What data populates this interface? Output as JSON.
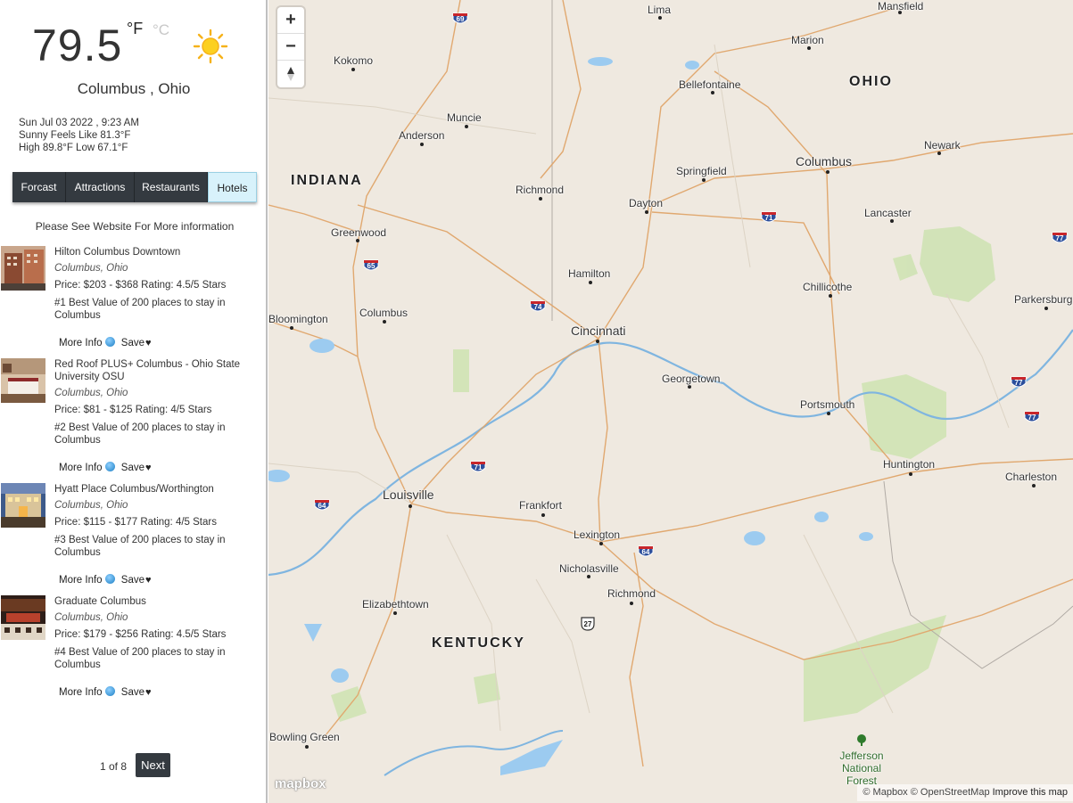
{
  "weather": {
    "temperature": "79.5",
    "unit_f": "°F",
    "unit_c": "°C",
    "icon": "sun-icon",
    "location": "Columbus , Ohio",
    "datetime": "Sun Jul 03 2022 , 9:23 AM",
    "feels": "Sunny Feels Like 81.3°F",
    "high_low": "High 89.8°F Low 67.1°F"
  },
  "tabs": [
    {
      "label": "Forcast",
      "active": false
    },
    {
      "label": "Attractions",
      "active": false
    },
    {
      "label": "Restaurants",
      "active": false
    },
    {
      "label": "Hotels",
      "active": true
    }
  ],
  "notice": "Please See Website For More information",
  "hotels": [
    {
      "name": "Hilton Columbus Downtown",
      "location": "Columbus, Ohio",
      "price": "Price: $203 - $368 Rating: 4.5/5 Stars",
      "rank": "#1 Best Value of 200 places to stay in Columbus",
      "more": "More Info",
      "save": "Save"
    },
    {
      "name": "Red Roof PLUS+ Columbus - Ohio State University OSU",
      "location": "Columbus, Ohio",
      "price": "Price: $81 - $125 Rating: 4/5 Stars",
      "rank": "#2 Best Value of 200 places to stay in Columbus",
      "more": "More Info",
      "save": "Save"
    },
    {
      "name": "Hyatt Place Columbus/Worthington",
      "location": "Columbus, Ohio",
      "price": "Price: $115 - $177 Rating: 4/5 Stars",
      "rank": "#3 Best Value of 200 places to stay in Columbus",
      "more": "More Info",
      "save": "Save"
    },
    {
      "name": "Graduate Columbus",
      "location": "Columbus, Ohio",
      "price": "Price: $179 - $256 Rating: 4.5/5 Stars",
      "rank": "#4 Best Value of 200 places to stay in Columbus",
      "more": "More Info",
      "save": "Save"
    }
  ],
  "pager": {
    "text": "1 of 8",
    "next": "Next"
  },
  "map": {
    "zoom_in": "+",
    "zoom_out": "−",
    "logo": "mapbox",
    "attribution": "© Mapbox © OpenStreetMap",
    "improve": "Improve this map",
    "states": [
      "INDIANA",
      "OHIO",
      "KENTUCKY"
    ],
    "cities": [
      "Lima",
      "Mansfield",
      "Marion",
      "Kokomo",
      "Bellefontaine",
      "Muncie",
      "Anderson",
      "Newark",
      "Springfield",
      "Columbus",
      "Richmond",
      "Dayton",
      "Lancaster",
      "Greenwood",
      "Hamilton",
      "Chillicothe",
      "Parkersburg",
      "Bloomington",
      "Columbus",
      "Cincinnati",
      "Georgetown",
      "Portsmouth",
      "Huntington",
      "Charleston",
      "Louisville",
      "Frankfort",
      "Lexington",
      "Nicholasville",
      "Richmond",
      "Elizabethtown",
      "Bowling Green",
      "Jefferson National Forest"
    ],
    "highways": [
      "69",
      "65",
      "74",
      "71",
      "71",
      "77",
      "77",
      "77",
      "64",
      "64",
      "27"
    ]
  }
}
